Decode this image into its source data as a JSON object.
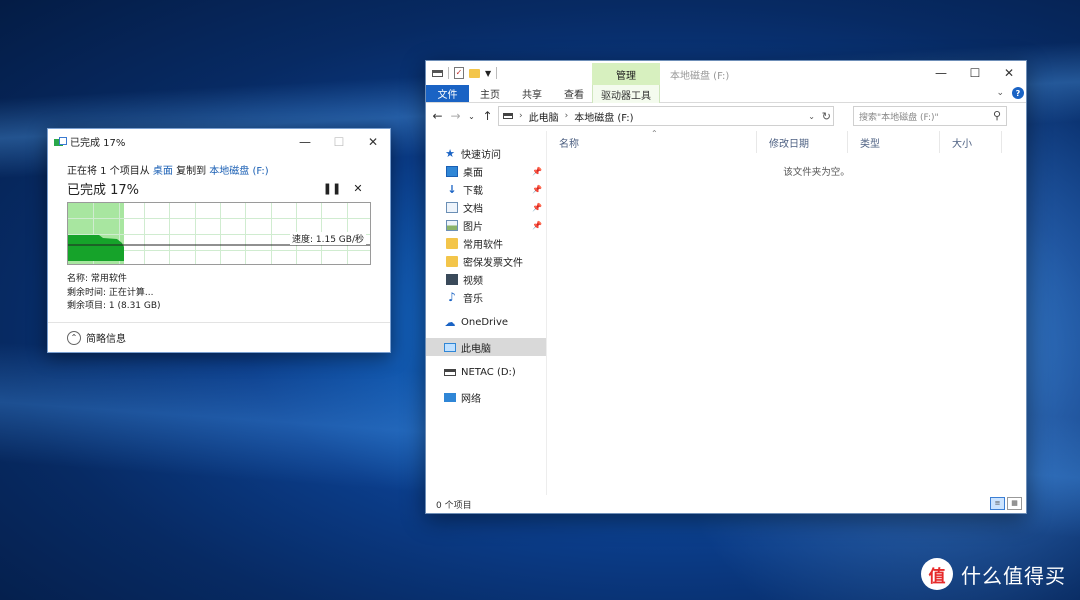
{
  "copy_dialog": {
    "title": "已完成 17%",
    "line_prefix": "正在将 1 个项目从",
    "source": "桌面",
    "line_mid": "复制到",
    "dest": "本地磁盘 (F:)",
    "percent_label": "已完成 17%",
    "progress": 0.17,
    "speed": "速度: 1.15 GB/秒",
    "name": "名称: 常用软件",
    "time_left": "剩余时间: 正在计算...",
    "items_left": "剩余项目: 1 (8.31 GB)",
    "less_details": "简略信息",
    "icons": {
      "pause": "pause-icon",
      "cancel": "close-icon"
    }
  },
  "explorer": {
    "title": "本地磁盘 (F:)",
    "manage_tab": "管理",
    "tabs": [
      "文件",
      "主页",
      "共享",
      "查看"
    ],
    "context_tab": "驱动器工具",
    "breadcrumb": [
      "此电脑",
      "本地磁盘 (F:)"
    ],
    "search_placeholder": "搜索\"本地磁盘 (F:)\"",
    "columns": [
      "名称",
      "修改日期",
      "类型",
      "大小"
    ],
    "empty_text": "该文件夹为空。",
    "status": "0 个项目",
    "quick_access": "快速访问",
    "pinned": [
      {
        "label": "桌面",
        "icon": "desktop-icon"
      },
      {
        "label": "下载",
        "icon": "download-icon"
      },
      {
        "label": "文档",
        "icon": "document-icon"
      },
      {
        "label": "图片",
        "icon": "picture-icon"
      }
    ],
    "folders": [
      {
        "label": "常用软件",
        "icon": "folder-icon"
      },
      {
        "label": "密保发票文件",
        "icon": "folder-icon"
      },
      {
        "label": "视频",
        "icon": "video-icon"
      },
      {
        "label": "音乐",
        "icon": "music-icon"
      }
    ],
    "onedrive": "OneDrive",
    "this_pc": "此电脑",
    "netac": "NETAC (D:)",
    "network": "网络"
  },
  "watermark": {
    "logo": "值",
    "text": "什么值得买"
  },
  "colors": {
    "accent": "#1a63c4",
    "manage_tab": "#d7f0bf",
    "progress_fill": "#a8e6a0",
    "graph_fill": "#16a32a"
  }
}
